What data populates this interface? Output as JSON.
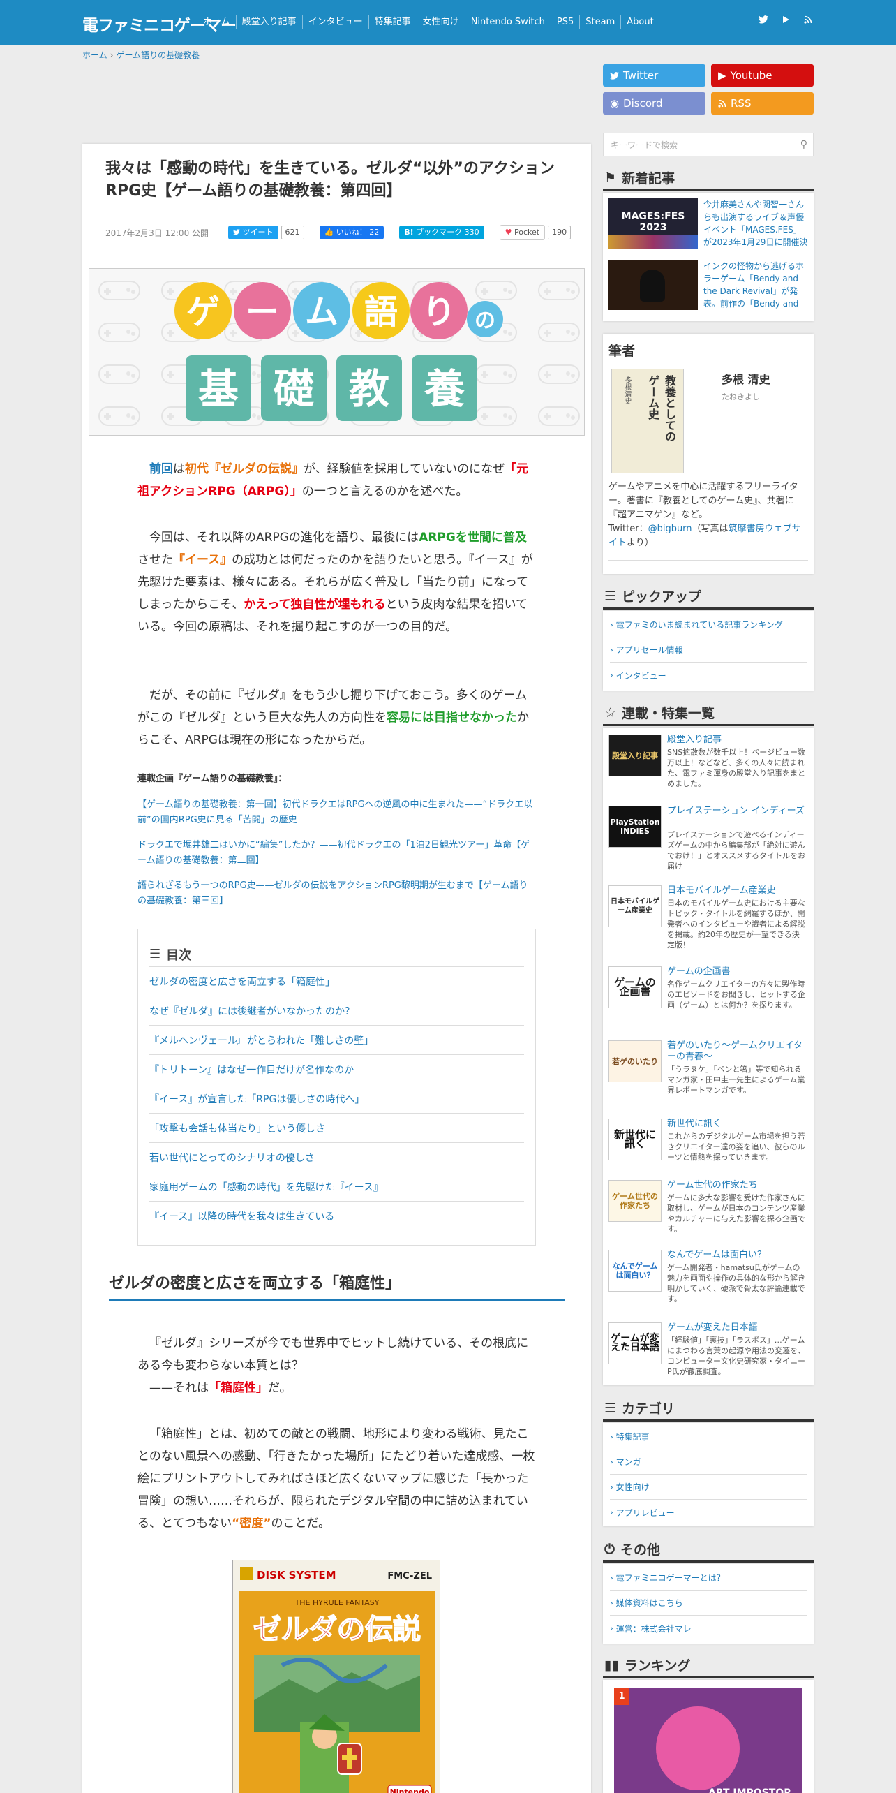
{
  "header": {
    "logo": "電ファミニコゲーマー",
    "nav": [
      "ホーム",
      "殿堂入り記事",
      "インタビュー",
      "特集記事",
      "女性向け",
      "Nintendo Switch",
      "PS5",
      "Steam",
      "About"
    ],
    "icons": [
      "twitter-icon",
      "youtube-icon",
      "rss-icon"
    ]
  },
  "breadcrumb": [
    "ホーム",
    "ゲーム語りの基礎教養"
  ],
  "article": {
    "title": "我々は「感動の時代」を生きている。ゼルダ“以外”のアクションRPG史【ゲーム語りの基礎教養：第四回】",
    "date": "2017年2月3日 12:00 公開",
    "share": {
      "tweet_label": "ツイート",
      "tweet_count": "621",
      "like_label": "いいね！",
      "like_count": "22",
      "hatena_label": "ブックマーク",
      "hatena_count": "330",
      "pocket_label": "Pocket",
      "pocket_count": "190"
    },
    "hero": {
      "line1": [
        "ゲ",
        "ー",
        "ム",
        "語",
        "り",
        "の"
      ],
      "line2": [
        "基",
        "礎",
        "教",
        "養"
      ]
    },
    "p1": {
      "s1": "前回",
      "s2": "は",
      "s3": "初代『ゼルダの伝説』",
      "s4": "が、経験値を採用していないのになぜ",
      "s5": "「元祖アクションRPG（ARPG）」",
      "s6": "の一つと言えるのかを述べた。"
    },
    "p2": {
      "s1": "今回は、それ以降のARPGの進化を語り、最後には",
      "s2": "ARPGを世間に普及",
      "s3": "させた",
      "s4": "『イース』",
      "s5": "の成功とは何だったのかを語りたいと思う。『イース』が先駆けた要素は、様々にある。それらが広く普及し「当たり前」になってしまったからこそ、",
      "s6": "かえって独自性が埋もれる",
      "s7": "という皮肉な結果を招いている。今回の原稿は、それを掘り起こすのが一つの目的だ。"
    },
    "p3": {
      "s1": "だが、その前に『ゼルダ』をもう少し掘り下げておこう。多くのゲームがこの『ゼルダ』という巨大な先人の方向性を",
      "s2": "容易には目指せなかった",
      "s3": "からこそ、ARPGは現在の形になったからだ。"
    },
    "series_title": "連載企画『ゲーム語りの基礎教養』：",
    "series_links": [
      "【ゲーム語りの基礎教養：第一回】初代ドラクエはRPGへの逆風の中に生まれた——“ドラクエ以前”の国内RPG史に見る「苦闘」の歴史",
      "ドラクエで堀井雄二はいかに“編集”したか？——初代ドラクエの「1泊2日観光ツアー」革命【ゲーム語りの基礎教養：第二回】",
      "語られざるもう一つのRPG史——ゼルダの伝説をアクションRPG黎明期が生むまで【ゲーム語りの基礎教養：第三回】"
    ],
    "toc": {
      "heading": "目次",
      "items": [
        "ゼルダの密度と広さを両立する「箱庭性」",
        "なぜ『ゼルダ』には後継者がいなかったのか？",
        "『メルヘンヴェール』がとらわれた「難しさの壁」",
        "『トリトーン』はなぜ一作目だけが名作なのか",
        "『イース』が宣言した「RPGは優しさの時代へ」",
        "「攻撃も会話も体当たり」という優しさ",
        "若い世代にとってのシナリオの優しさ",
        "家庭用ゲームの「感動の時代」を先駆けた『イース』",
        "『イース』以降の時代を我々は生きている"
      ]
    },
    "h2": "ゼルダの密度と広さを両立する「箱庭性」",
    "p4": {
      "s1": "『ゼルダ』シリーズが今でも世界中でヒットし続けている、その根底にある今も変わらない本質とは？",
      "s2": "——それは",
      "s3": "「箱庭性」",
      "s4": "だ。"
    },
    "p5": {
      "s1": "「箱庭性」とは、初めての敵との戦闘、地形により変わる戦術、見たことのない風景への感動、「行きたかった場所」にたどり着いた達成感、一枚絵にプリントアウトしてみればさほど広くないマップに感じた「長かった冒険」の想い……それらが、限られたデジタル空間の中に詰め込まれている、とてつもない",
      "s2": "“密度”",
      "s3": "のことだ。"
    },
    "boxart": {
      "top_left": "DISK SYSTEM",
      "top_right": "FMC-ZEL",
      "subtitle": "THE HYRULE FANTASY",
      "title": "ゼルダの伝説",
      "bottom": "Nintendo"
    }
  },
  "sidebar": {
    "social": {
      "twitter": "Twitter",
      "youtube": "Youtube",
      "discord": "Discord",
      "rss": "RSS"
    },
    "search_placeholder": "キーワードで検索",
    "new_articles": {
      "heading": "新着記事",
      "items": [
        {
          "thumb": "MAGES:FES 2023",
          "text": "今井麻美さんや関智一さんらも出演するライブ＆声優イベント「MAGES.FES」が2023年1月29日に開催決"
        },
        {
          "thumb": "",
          "text": "インクの怪物から逃げるホラーゲーム「Bendy and the Dark Revival」が発表。前作の「Bendy and"
        }
      ]
    },
    "author": {
      "heading": "筆者",
      "name": "多根 清史",
      "reading": "たねきよし",
      "book_title": "教養としてのゲーム史",
      "book_author": "多根清史",
      "bio1": "ゲームやアニメを中心に活躍するフリーライター。著書に『教養としてのゲーム史』、共著に『超アニマゲン』など。",
      "bio2": "Twitter：",
      "handle": "@bigburn",
      "bio3": "（写真は",
      "bio_link": "筑摩書房ウェブサイト",
      "bio4": "より）"
    },
    "pickup": {
      "heading": "ピックアップ",
      "items": [
        "電ファミのいま読まれている記事ランキング",
        "アプリセール情報",
        "インタビュー"
      ]
    },
    "series": {
      "heading": "連載・特集一覧",
      "items": [
        {
          "thumb": "殿堂入り記事",
          "title": "殿堂入り記事",
          "desc": "SNS拡散数が数千以上！ページビュー数万以上！などなど、多くの人々に読まれた、電ファミ渾身の殿堂入り記事をまとめました。"
        },
        {
          "thumb": "PlayStation INDIES",
          "title": "プレイステーション インディーズ",
          "desc": "プレイステーションで遊べるインディーズゲームの中から編集部が「絶対に遊んでおけ！」とオススメするタイトルをお届け"
        },
        {
          "thumb": "日本モバイルゲーム産業史",
          "title": "日本モバイルゲーム産業史",
          "desc": "日本のモバイルゲーム史における主要なトピック・タイトルを網羅するほか、開発者へのインタビューや識者による解説を掲載。約20年の歴史が一望できる決定版！"
        },
        {
          "thumb": "ゲームの企画書",
          "title": "ゲームの企画書",
          "desc": "名作ゲームクリエイターの方々に製作時のエピソードをお聞きし、ヒットする企画（ゲーム）とは何か？を探ります。"
        },
        {
          "thumb": "若ゲのいたり",
          "title": "若ゲのいたり〜ゲームクリエイターの青春〜",
          "desc": "「うラヌケ」「ペンと箸」等で知られるマンガ家・田中圭一先生によるゲーム業界レポートマンガです。"
        },
        {
          "thumb": "新世代に訊く",
          "title": "新世代に訊く",
          "desc": "これからのデジタルゲーム市場を担う若きクリエイター達の姿を追い、彼らのルーツと情熱を探っていきます。"
        },
        {
          "thumb": "ゲーム世代の作家たち",
          "title": "ゲーム世代の作家たち",
          "desc": "ゲームに多大な影響を受けた作家さんに取材し、ゲームが日本のコンテンツ産業やカルチャーに与えた影響を探る企画です。"
        },
        {
          "thumb": "なんでゲームは面白い？",
          "title": "なんでゲームは面白い？",
          "desc": "ゲーム開発者・hamatsu氏がゲームの魅力を画面や操作の具体的な形から解き明かしていく、硬派で骨太な評論連載です。"
        },
        {
          "thumb": "ゲームが変えた日本語",
          "title": "ゲームが変えた日本語",
          "desc": "「経験値」「裏技」「ラスボス」…ゲームにまつわる言葉の起源や用法の変遷を、コンピューター文化史研究家・タイニーP氏が徹底調査。"
        }
      ]
    },
    "category": {
      "heading": "カテゴリ",
      "items": [
        "特集記事",
        "マンガ",
        "女性向け",
        "アプリレビュー"
      ]
    },
    "other": {
      "heading": "その他",
      "items": [
        "電ファミニコゲーマーとは？",
        "媒体資料はこちら",
        "運営：株式会社マレ"
      ]
    },
    "ranking": {
      "heading": "ランキング",
      "rank": "1",
      "caption": "ART IMPOSTOR"
    }
  },
  "colors": {
    "header": "#1e8bc3",
    "link": "#1e7bb8",
    "red": "#e60012",
    "orange": "#e8710a",
    "green": "#1f9d2b"
  }
}
